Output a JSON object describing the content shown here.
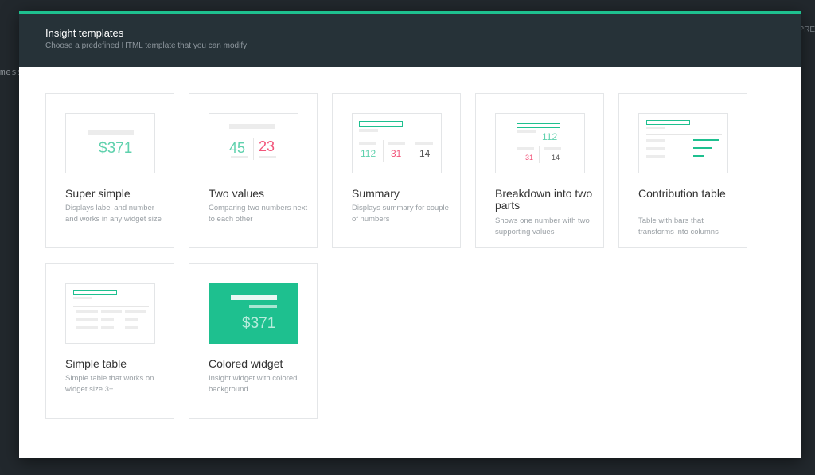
{
  "background": {
    "left_text": "mess",
    "right_text": "PRE"
  },
  "modal": {
    "title": "Insight templates",
    "subtitle": "Choose a predefined HTML template that you can modify"
  },
  "colors": {
    "accent": "#1ec08f",
    "negative": "#f2547a",
    "header_bg": "#263238"
  },
  "templates": [
    {
      "title": "Super simple",
      "description": "Displays label and number and works in any widget size",
      "preview": {
        "value": "$371"
      }
    },
    {
      "title": "Two values",
      "description": "Comparing two numbers next to each other",
      "preview": {
        "left": "45",
        "right": "23"
      }
    },
    {
      "title": "Summary",
      "description": "Displays summary for couple of numbers",
      "preview": {
        "a": "112",
        "b": "31",
        "c": "14"
      }
    },
    {
      "title": "Breakdown into two parts",
      "description": "Shows one number with two supporting values",
      "preview": {
        "main": "112",
        "left": "31",
        "right": "14"
      }
    },
    {
      "title": "Contribution table",
      "description": "Table with bars that transforms into columns"
    },
    {
      "title": "Simple table",
      "description": "Simple table that works on widget size 3+"
    },
    {
      "title": "Colored widget",
      "description": "Insight widget with colored background",
      "preview": {
        "value": "$371"
      }
    }
  ]
}
